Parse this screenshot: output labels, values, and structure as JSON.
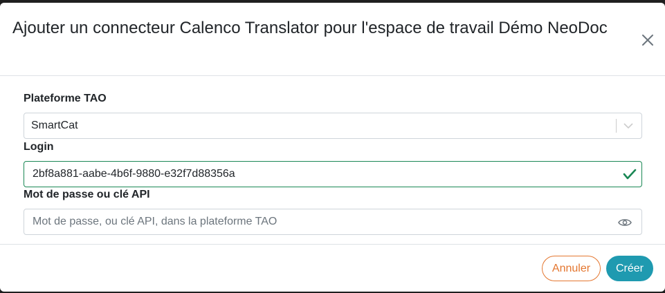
{
  "modal": {
    "title": "Ajouter un connecteur Calenco Translator pour l'espace de travail Démo NeoDoc",
    "close_icon": "close-icon"
  },
  "form": {
    "platform": {
      "label": "Plateforme TAO",
      "value": "SmartCat",
      "icon": "chevron-down-icon"
    },
    "login": {
      "label": "Login",
      "value": "2bf8a881-aabe-4b6f-9880-e32f7d88356a",
      "status": "valid",
      "icon": "check-icon",
      "status_color": "#198754"
    },
    "password": {
      "label": "Mot de passe ou clé API",
      "value": "",
      "placeholder": "Mot de passe, ou clé API, dans la plateforme TAO",
      "icon": "eye-icon"
    }
  },
  "footer": {
    "cancel_label": "Annuler",
    "create_label": "Créer",
    "cancel_color": "#e4762f",
    "create_color": "#1f9ab0"
  }
}
